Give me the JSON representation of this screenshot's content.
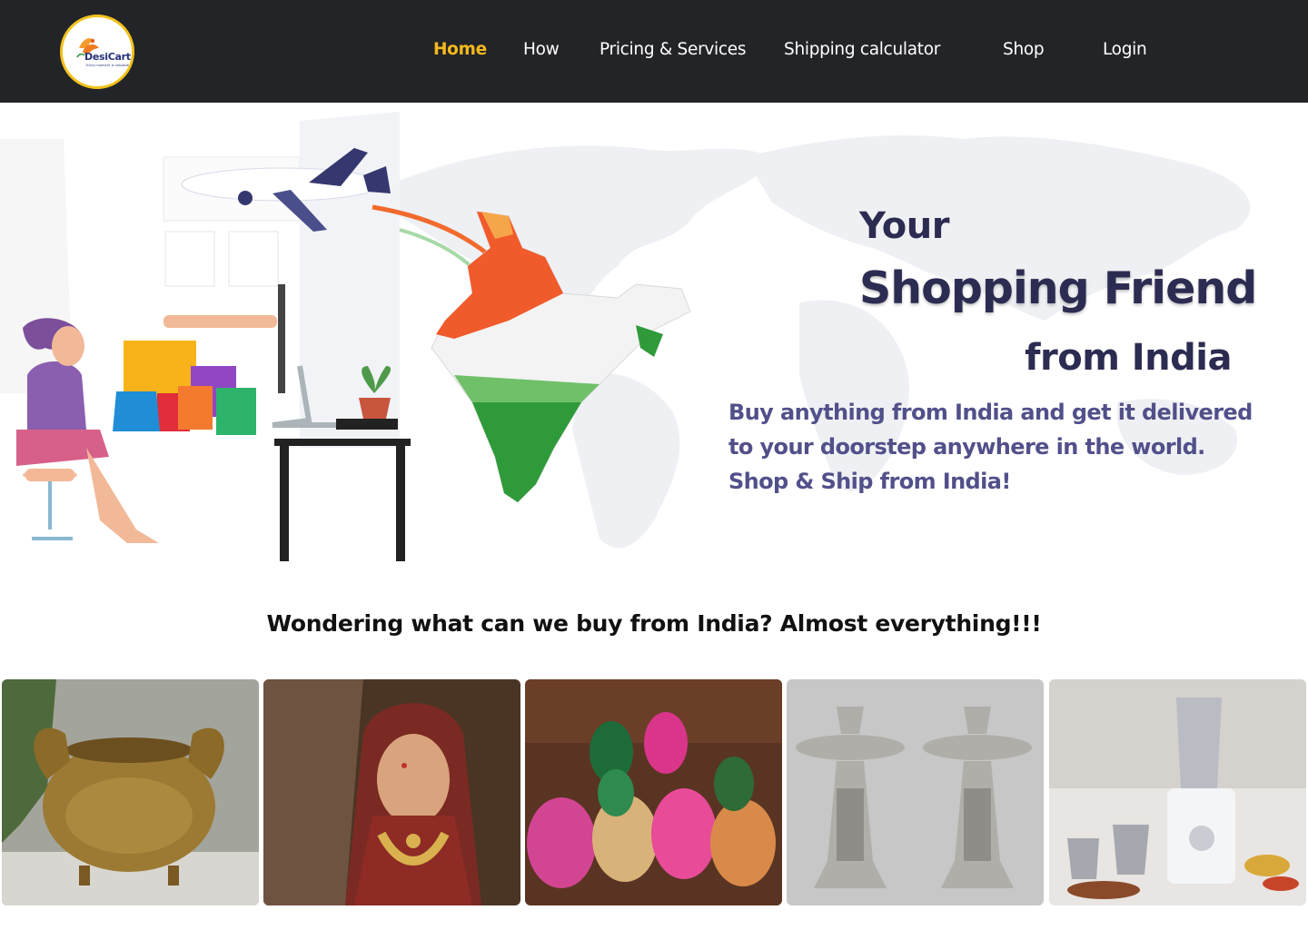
{
  "brand": {
    "name": "DesiCart",
    "tagline": "Every moment is valuable",
    "colors": {
      "nav_bg": "#232428",
      "accent": "#f6b91c",
      "heading": "#2c2c52",
      "text": "#52508a"
    }
  },
  "nav": {
    "items": [
      {
        "label": "Home",
        "active": true
      },
      {
        "label": "How",
        "active": false
      },
      {
        "label": "Pricing & Services",
        "active": false
      },
      {
        "label": "Shipping calculator",
        "active": false
      },
      {
        "label": "Shop",
        "active": false
      },
      {
        "label": "Login",
        "active": false
      }
    ]
  },
  "hero": {
    "title_line1": "Your",
    "title_line2": "Shopping Friend",
    "title_line3": "from India",
    "description_lines": [
      "Buy anything from India and get it delivered",
      "to your doorstep anywhere in the world.",
      "Shop & Ship from India!"
    ]
  },
  "buy_section": {
    "heading": "Wondering what can we buy from India? Almost everything!!!",
    "products": [
      "brass-urn",
      "bridal-jewelry",
      "potli-bags",
      "silver-lamps",
      "mixer-grinder"
    ]
  }
}
